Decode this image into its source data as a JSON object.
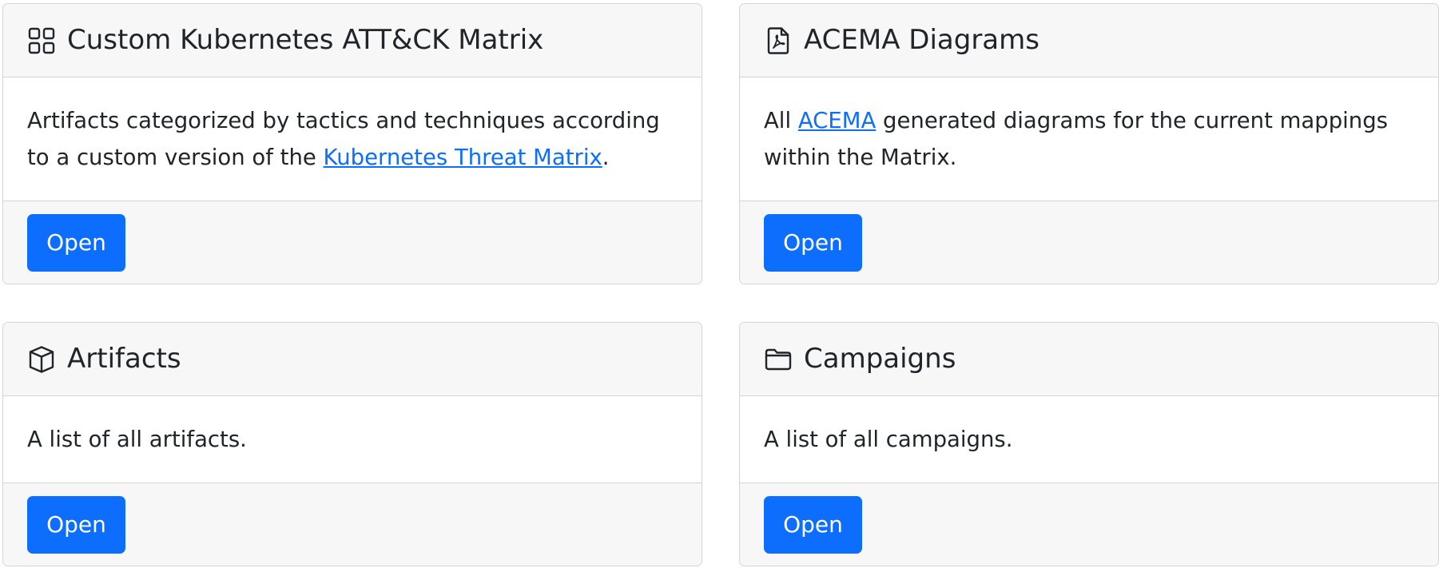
{
  "cards": [
    {
      "icon": "grid-icon",
      "title": "Custom Kubernetes ATT&CK Matrix",
      "text_before": "Artifacts categorized by tactics and techniques according to a custom version of the ",
      "link_text": "Kubernetes Threat Matrix",
      "text_after": ".",
      "button_label": "Open"
    },
    {
      "icon": "pdf-file-icon",
      "title": "ACEMA Diagrams",
      "text_before": "All ",
      "link_text": "ACEMA",
      "text_after": " generated diagrams for the current mappings within the Matrix.",
      "button_label": "Open"
    },
    {
      "icon": "box-icon",
      "title": "Artifacts",
      "text": "A list of all artifacts.",
      "button_label": "Open"
    },
    {
      "icon": "folder-icon",
      "title": "Campaigns",
      "text": "A list of all campaigns.",
      "button_label": "Open"
    }
  ],
  "colors": {
    "primary": "#0d6efd",
    "header_bg": "#f7f7f7",
    "border": "#d4d4d4",
    "text": "#212529"
  }
}
